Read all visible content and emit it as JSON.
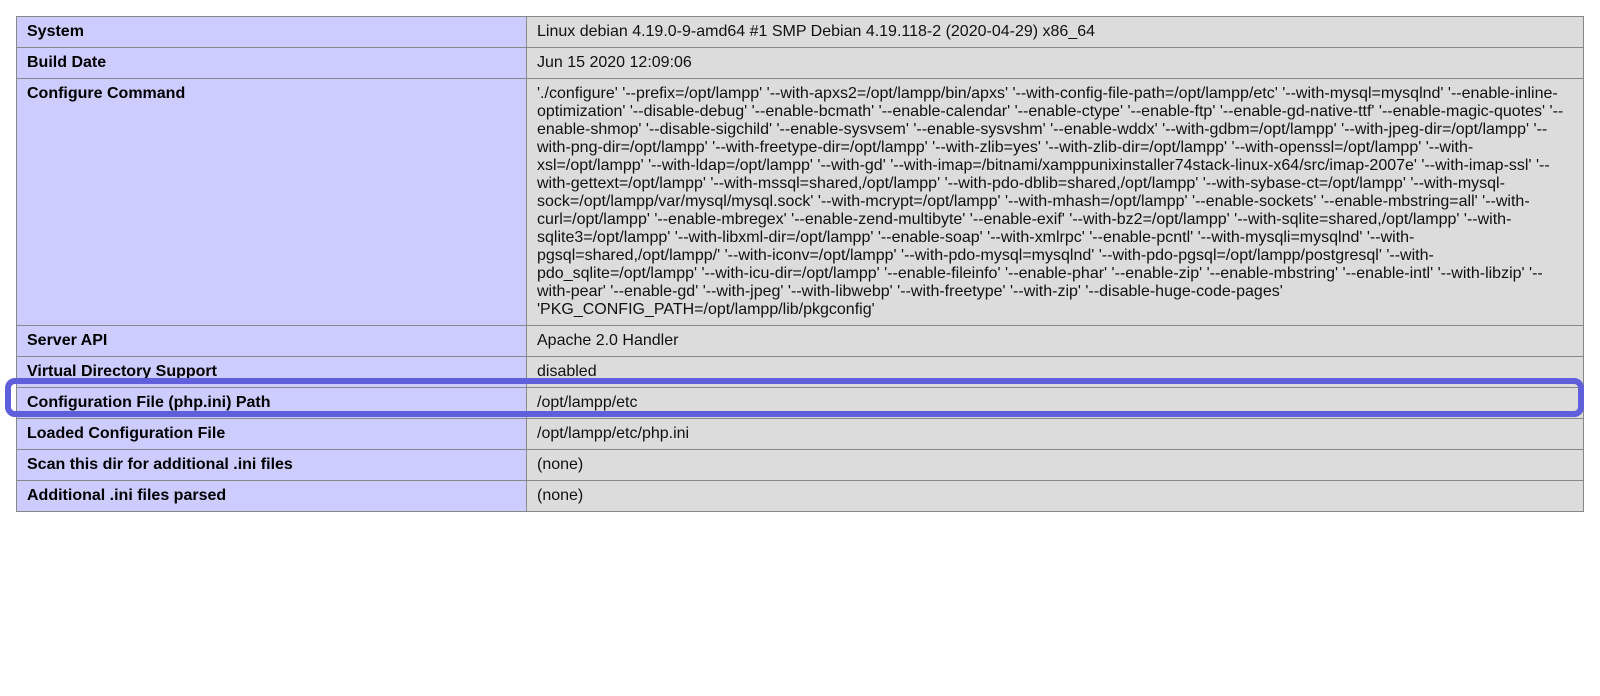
{
  "rows": [
    {
      "key": "System",
      "val": "Linux debian 4.19.0-9-amd64 #1 SMP Debian 4.19.118-2 (2020-04-29) x86_64"
    },
    {
      "key": "Build Date",
      "val": "Jun 15 2020 12:09:06"
    },
    {
      "key": "Configure Command",
      "val": "'./configure'  '--prefix=/opt/lampp' '--with-apxs2=/opt/lampp/bin/apxs' '--with-config-file-path=/opt/lampp/etc' '--with-mysql=mysqlnd' '--enable-inline-optimization' '--disable-debug' '--enable-bcmath' '--enable-calendar' '--enable-ctype' '--enable-ftp' '--enable-gd-native-ttf' '--enable-magic-quotes' '--enable-shmop' '--disable-sigchild' '--enable-sysvsem' '--enable-sysvshm' '--enable-wddx' '--with-gdbm=/opt/lampp' '--with-jpeg-dir=/opt/lampp' '--with-png-dir=/opt/lampp' '--with-freetype-dir=/opt/lampp' '--with-zlib=yes' '--with-zlib-dir=/opt/lampp' '--with-openssl=/opt/lampp' '--with-xsl=/opt/lampp' '--with-ldap=/opt/lampp' '--with-gd' '--with-imap=/bitnami/xamppunixinstaller74stack-linux-x64/src/imap-2007e' '--with-imap-ssl' '--with-gettext=/opt/lampp' '--with-mssql=shared,/opt/lampp' '--with-pdo-dblib=shared,/opt/lampp' '--with-sybase-ct=/opt/lampp' '--with-mysql-sock=/opt/lampp/var/mysql/mysql.sock' '--with-mcrypt=/opt/lampp' '--with-mhash=/opt/lampp' '--enable-sockets' '--enable-mbstring=all' '--with-curl=/opt/lampp' '--enable-mbregex' '--enable-zend-multibyte' '--enable-exif' '--with-bz2=/opt/lampp' '--with-sqlite=shared,/opt/lampp' '--with-sqlite3=/opt/lampp' '--with-libxml-dir=/opt/lampp' '--enable-soap' '--with-xmlrpc' '--enable-pcntl' '--with-mysqli=mysqlnd' '--with-pgsql=shared,/opt/lampp/' '--with-iconv=/opt/lampp' '--with-pdo-mysql=mysqlnd' '--with-pdo-pgsql=/opt/lampp/postgresql' '--with-pdo_sqlite=/opt/lampp' '--with-icu-dir=/opt/lampp' '--enable-fileinfo' '--enable-phar' '--enable-zip' '--enable-mbstring' '--enable-intl' '--with-libzip' '--with-pear' '--enable-gd' '--with-jpeg' '--with-libwebp' '--with-freetype' '--with-zip' '--disable-huge-code-pages' 'PKG_CONFIG_PATH=/opt/lampp/lib/pkgconfig'"
    },
    {
      "key": "Server API",
      "val": "Apache 2.0 Handler"
    },
    {
      "key": "Virtual Directory Support",
      "val": "disabled"
    },
    {
      "key": "Configuration File (php.ini) Path",
      "val": "/opt/lampp/etc"
    },
    {
      "key": "Loaded Configuration File",
      "val": "/opt/lampp/etc/php.ini"
    },
    {
      "key": "Scan this dir for additional .ini files",
      "val": "(none)"
    },
    {
      "key": "Additional .ini files parsed",
      "val": "(none)"
    }
  ],
  "highlight_index": 5
}
